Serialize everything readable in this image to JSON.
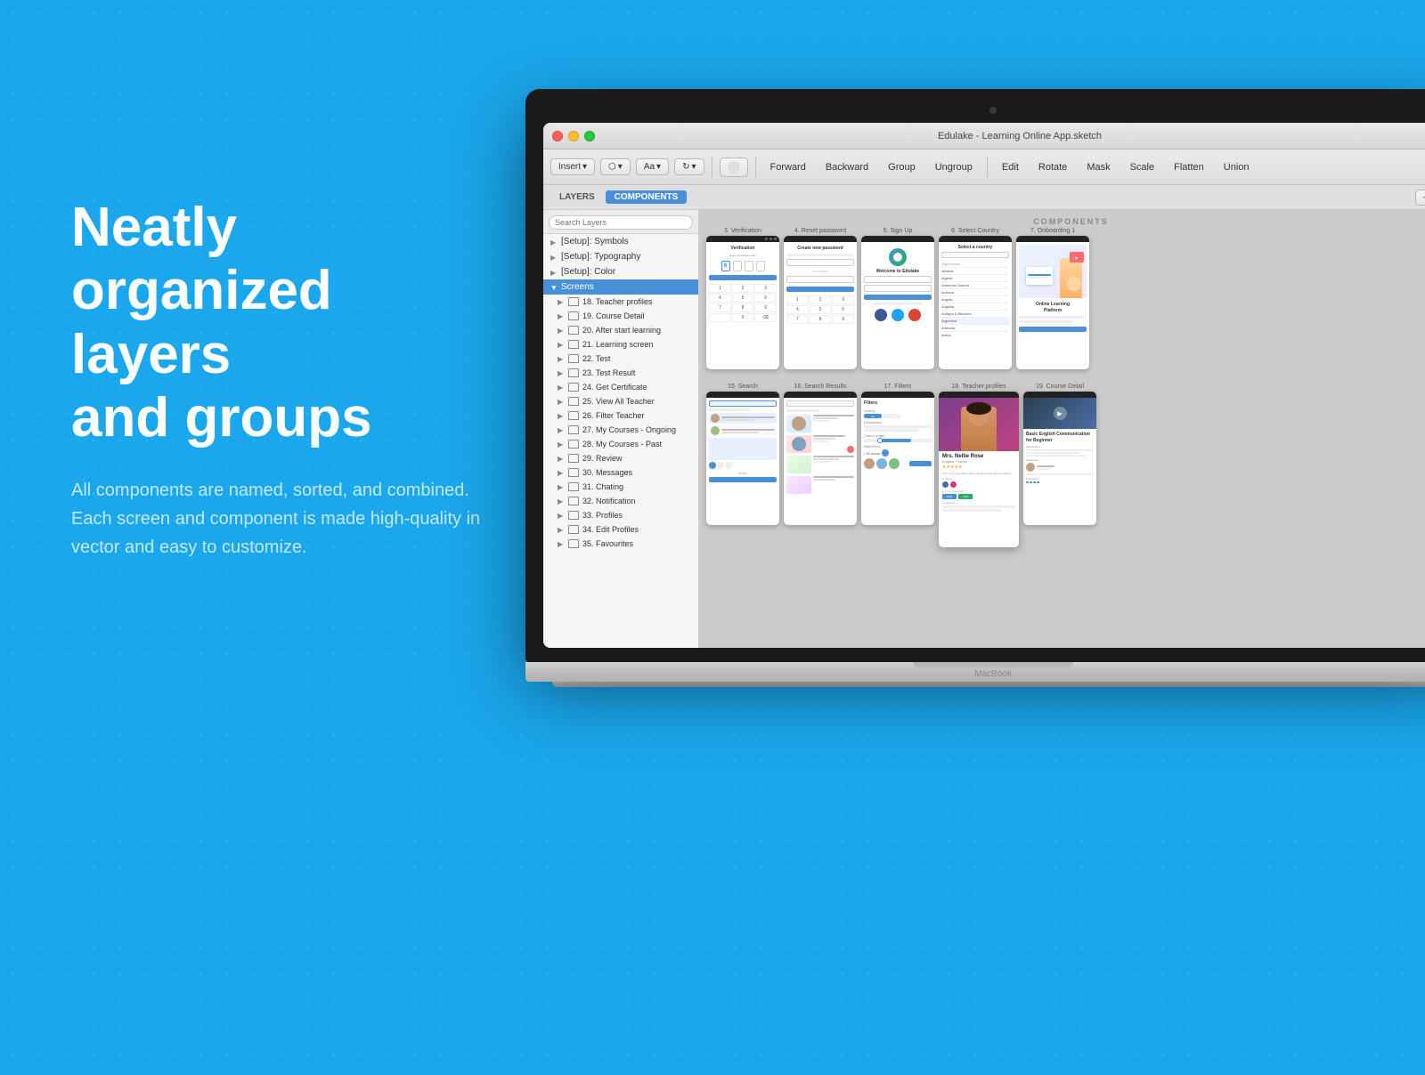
{
  "background": {
    "color": "#1aa7ec"
  },
  "left_panel": {
    "headline_line1": "Neatly",
    "headline_line2": "organized layers",
    "headline_line3": "and groups",
    "description": "All components are named, sorted, and combined. Each screen and component is made high-quality in vector and easy to customize."
  },
  "macbook": {
    "brand": "MacBook",
    "sketch_title": "Edulake - Learning Online App.sketch"
  },
  "toolbar": {
    "insert": "Insert",
    "data": "Data",
    "text_styles": "Text Styles",
    "symbols": "Symbols",
    "create_symbol": "Create Symbol",
    "forward": "Forward",
    "backward": "Backward",
    "group": "Group",
    "ungroup": "Ungroup",
    "edit": "Edit",
    "rotate": "Rotate",
    "mask": "Mask",
    "scale": "Scale",
    "flatten": "Flatten",
    "union": "Union"
  },
  "sidebar": {
    "layers_label": "LAYERS",
    "components_label": "COMPONENTS",
    "search_placeholder": "Search Layers",
    "static_items": [
      "[Setup]: Symbols",
      "[Setup]: Typography",
      "[Setup]: Color"
    ],
    "active_group": "Screens",
    "layer_items": [
      "18. Teacher profiles",
      "19. Course Detail",
      "20. After start learning",
      "21. Learning screen",
      "22. Test",
      "23. Test Result",
      "24. Get Certificate",
      "25. View All Teacher",
      "26. Filter Teacher",
      "27. My Courses - Ongoing",
      "28. My Courses - Past",
      "29. Review",
      "30. Messages",
      "31. Chating",
      "32. Notification",
      "33. Profiles",
      "34. Edit Profiles",
      "35. Favourites"
    ]
  },
  "canvas": {
    "watermark": "COMPONENTS",
    "top_row_screens": [
      {
        "number": "3.",
        "title": "Verification"
      },
      {
        "number": "4.",
        "title": "Reset password"
      },
      {
        "number": "5.",
        "title": "Sign Up"
      },
      {
        "number": "6.",
        "title": "Select Country"
      },
      {
        "number": "7.",
        "title": "Onboarding 1"
      }
    ],
    "bottom_row_screens": [
      {
        "number": "15.",
        "title": "Search"
      },
      {
        "number": "16.",
        "title": "Search Results"
      },
      {
        "number": "17.",
        "title": "Filters"
      },
      {
        "number": "18.",
        "title": "Teacher profiles"
      },
      {
        "number": "19.",
        "title": "Course Detail"
      }
    ]
  },
  "highlighted_items": {
    "teacher_profiles": "18 . Teacher profiles",
    "start_learning": "start learning",
    "profiles": "33. Profiles"
  }
}
